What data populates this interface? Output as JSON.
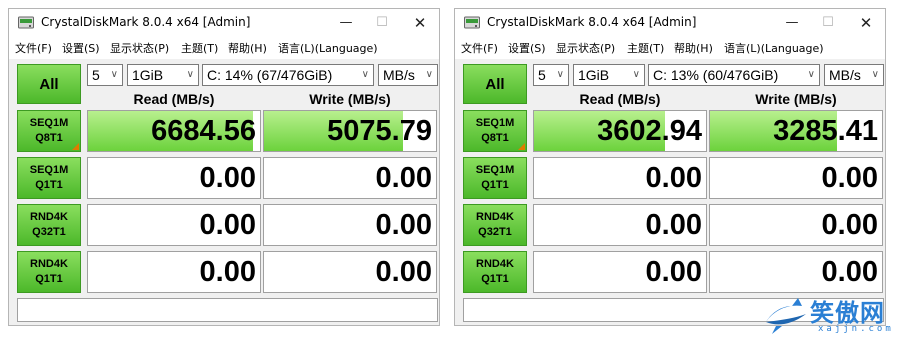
{
  "windows": [
    {
      "title": "CrystalDiskMark 8.0.4 x64 [Admin]",
      "menus": [
        "文件(F)",
        "设置(S)",
        "显示状态(P)",
        "主题(T)",
        "帮助(H)",
        "语言(L)(Language)"
      ],
      "all_label": "All",
      "count": "5",
      "size": "1GiB",
      "drive": "C: 14% (67/476GiB)",
      "unit": "MB/s",
      "read_header": "Read (MB/s)",
      "write_header": "Write (MB/s)",
      "tests": [
        {
          "line1": "SEQ1M",
          "line2": "Q8T1",
          "read": "6684.56",
          "write": "5075.79",
          "read_fill": 0.96,
          "write_fill": 0.81
        },
        {
          "line1": "SEQ1M",
          "line2": "Q1T1",
          "read": "0.00",
          "write": "0.00",
          "read_fill": 0,
          "write_fill": 0
        },
        {
          "line1": "RND4K",
          "line2": "Q32T1",
          "read": "0.00",
          "write": "0.00",
          "read_fill": 0,
          "write_fill": 0
        },
        {
          "line1": "RND4K",
          "line2": "Q1T1",
          "read": "0.00",
          "write": "0.00",
          "read_fill": 0,
          "write_fill": 0
        }
      ],
      "status": ""
    },
    {
      "title": "CrystalDiskMark 8.0.4 x64 [Admin]",
      "menus": [
        "文件(F)",
        "设置(S)",
        "显示状态(P)",
        "主题(T)",
        "帮助(H)",
        "语言(L)(Language)"
      ],
      "all_label": "All",
      "count": "5",
      "size": "1GiB",
      "drive": "C: 13% (60/476GiB)",
      "unit": "MB/s",
      "read_header": "Read (MB/s)",
      "write_header": "Write (MB/s)",
      "tests": [
        {
          "line1": "SEQ1M",
          "line2": "Q8T1",
          "read": "3602.94",
          "write": "3285.41",
          "read_fill": 0.76,
          "write_fill": 0.74
        },
        {
          "line1": "SEQ1M",
          "line2": "Q1T1",
          "read": "0.00",
          "write": "0.00",
          "read_fill": 0,
          "write_fill": 0
        },
        {
          "line1": "RND4K",
          "line2": "Q32T1",
          "read": "0.00",
          "write": "0.00",
          "read_fill": 0,
          "write_fill": 0
        },
        {
          "line1": "RND4K",
          "line2": "Q1T1",
          "read": "0.00",
          "write": "0.00",
          "read_fill": 0,
          "write_fill": 0
        }
      ],
      "status": ""
    }
  ],
  "watermark": {
    "text": "笑傲网",
    "sub": "xajjn.com"
  },
  "colors": {
    "button_green": "#4cb82a",
    "bar_green": "#6cd23c",
    "marker_orange": "#e07b00",
    "watermark_blue": "#2a7fd4"
  }
}
